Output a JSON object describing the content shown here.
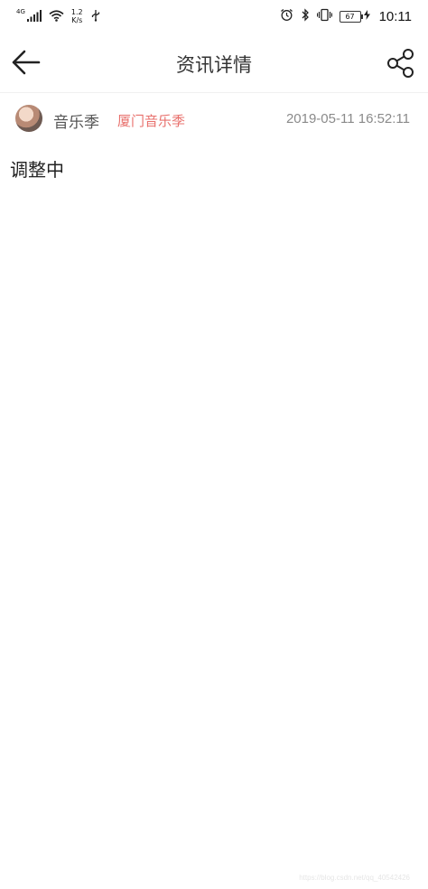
{
  "status_bar": {
    "network_type": "4G",
    "net_speed_value": "1.2",
    "net_speed_unit": "K/s",
    "battery_level": "67",
    "time": "10:11"
  },
  "header": {
    "title": "资讯详情",
    "back_icon": "arrow-left-icon",
    "share_icon": "share-icon"
  },
  "article": {
    "author_name": "音乐季",
    "author_tag": "厦门音乐季",
    "publish_time": "2019-05-11 16:52:11",
    "body": "调整中"
  },
  "colors": {
    "tag": "#e8706c",
    "time": "#8a8a8a",
    "title": "#333333"
  },
  "watermark": "https://blog.csdn.net/qq_40542426"
}
